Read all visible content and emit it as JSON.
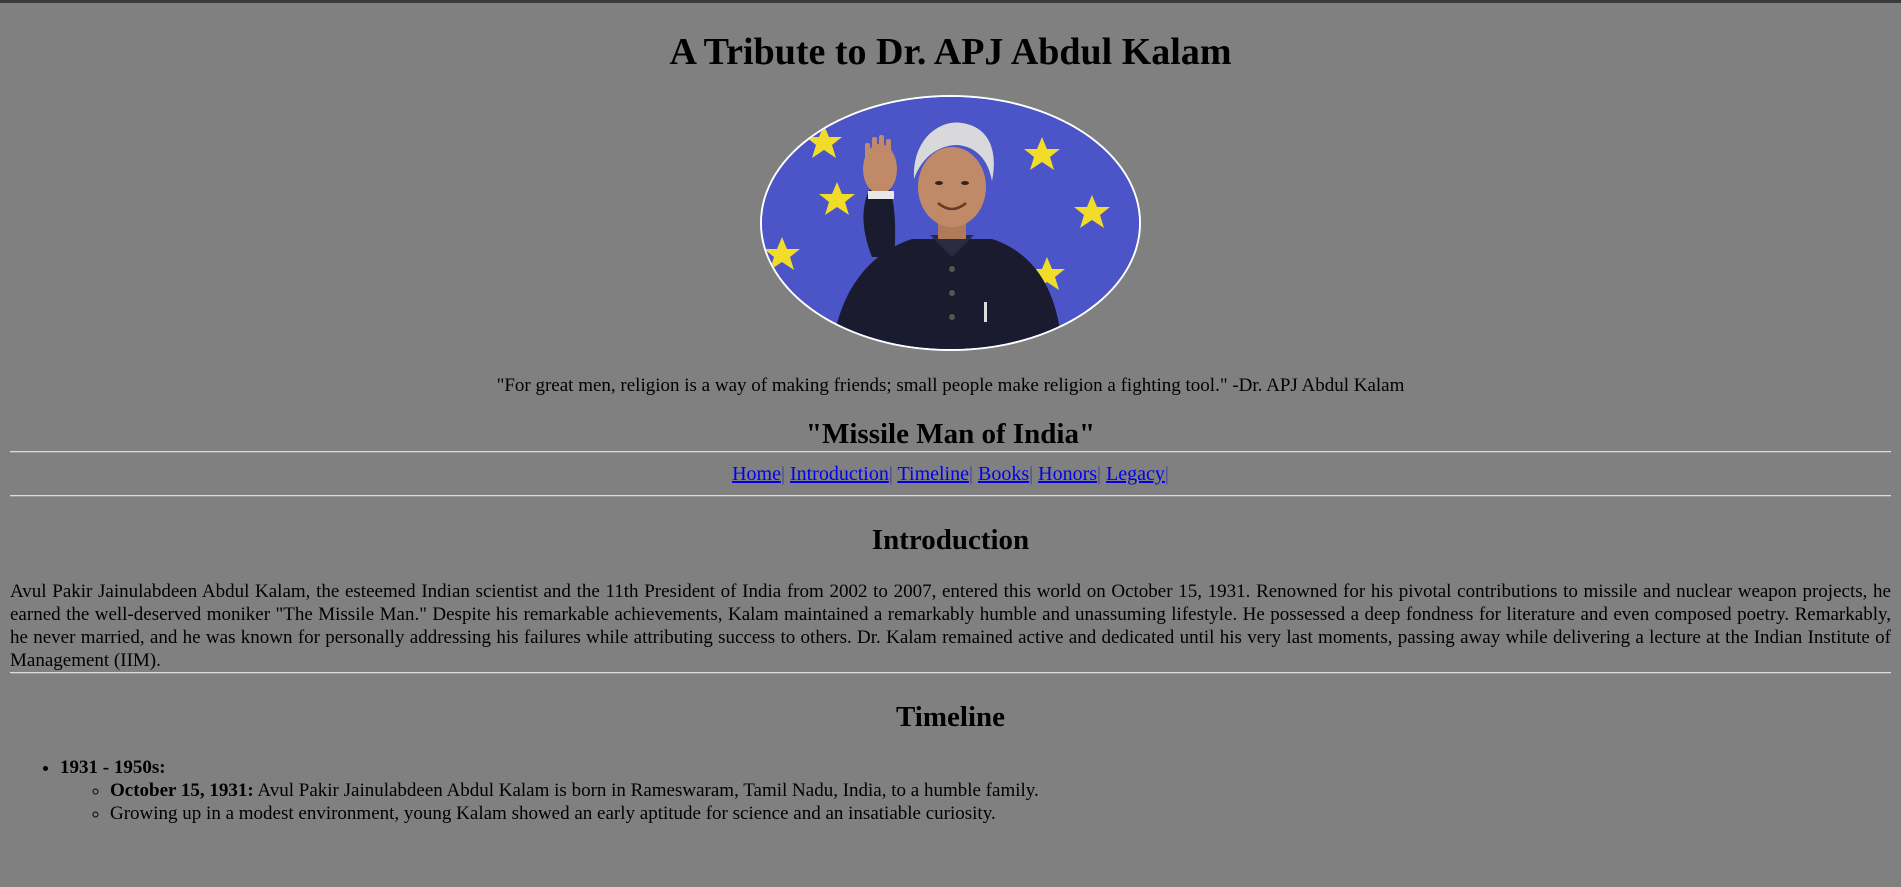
{
  "header": {
    "title": "A Tribute to Dr. APJ Abdul Kalam",
    "quote": "\"For great men, religion is a way of making friends; small people make religion a fighting tool.\" -Dr. APJ Abdul Kalam",
    "subtitle": "\"Missile Man of India\""
  },
  "nav": {
    "items": [
      {
        "label": "Home",
        "sep": "|"
      },
      {
        "label": "Introduction",
        "sep": "|"
      },
      {
        "label": "Timeline",
        "sep": "|"
      },
      {
        "label": "Books",
        "sep": "|"
      },
      {
        "label": "Honors",
        "sep": "|"
      },
      {
        "label": "Legacy",
        "sep": "|"
      }
    ]
  },
  "introduction": {
    "heading": "Introduction",
    "body": "Avul Pakir Jainulabdeen Abdul Kalam, the esteemed Indian scientist and the 11th President of India from 2002 to 2007, entered this world on October 15, 1931. Renowned for his pivotal contributions to missile and nuclear weapon projects, he earned the well-deserved moniker \"The Missile Man.\" Despite his remarkable achievements, Kalam maintained a remarkably humble and unassuming lifestyle. He possessed a deep fondness for literature and even composed poetry. Remarkably, he never married, and he was known for personally addressing his failures while attributing success to others. Dr. Kalam remained active and dedicated until his very last moments, passing away while delivering a lecture at the Indian Institute of Management (IIM)."
  },
  "timeline": {
    "heading": "Timeline",
    "periods": [
      {
        "label": "1931 - 1950s:",
        "events": [
          {
            "date": "October 15, 1931:",
            "text": " Avul Pakir Jainulabdeen Abdul Kalam is born in Rameswaram, Tamil Nadu, India, to a humble family."
          },
          {
            "date": "",
            "text": "Growing up in a modest environment, young Kalam showed an early aptitude for science and an insatiable curiosity."
          }
        ]
      }
    ]
  },
  "colors": {
    "background": "#808080",
    "link": "#0000ee",
    "portrait_border": "#ffffff",
    "flag_blue": "#4b55c8",
    "star_yellow": "#f2dc2a"
  },
  "icons": {
    "portrait": "portrait-photo"
  }
}
